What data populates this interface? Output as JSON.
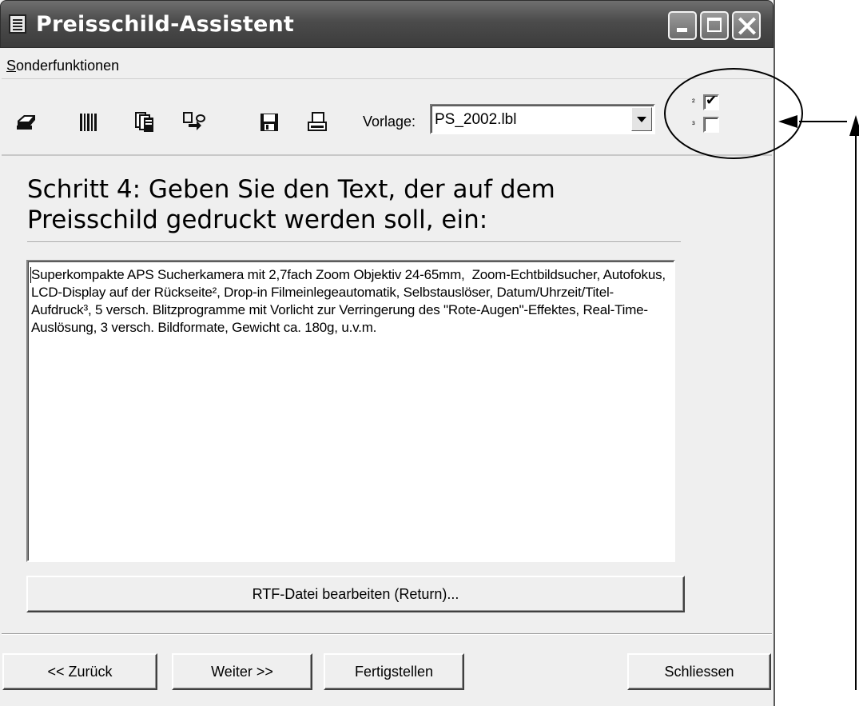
{
  "window": {
    "title": "Preisschild-Assistent"
  },
  "menu": {
    "sonderfunktionen_prefix": "S",
    "sonderfunktionen_rest": "onderfunktionen"
  },
  "toolbar": {
    "icons": [
      "printer-icon",
      "barcode-icon",
      "copy-pages-icon",
      "transfer-icon",
      "save-icon",
      "print-preview-icon"
    ],
    "vorlage_label": "Vorlage:",
    "vorlage_value": "PS_2002.lbl",
    "footnote_2": "²",
    "footnote_3": "³",
    "check_2": true,
    "check_3": false
  },
  "step": {
    "heading": "Schritt 4: Geben Sie den Text, der auf dem Preisschild gedruckt werden soll, ein:"
  },
  "editor": {
    "text": "Superkompakte APS Sucherkamera mit 2,7fach Zoom Objektiv 24-65mm,  Zoom-Echtbildsucher, Autofokus, LCD-Display auf der Rückseite², Drop-in Filmeinlegeautomatik, Selbstauslöser, Datum/Uhrzeit/Titel-Aufdruck³, 5 versch. Blitzprogramme mit Vorlicht zur Verringerung des \"Rote-Augen\"-Effektes, Real-Time-Auslösung, 3 versch. Bildformate, Gewicht ca. 180g, u.v.m."
  },
  "buttons": {
    "rtf": "RTF-Datei bearbeiten (Return)...",
    "back": "<< Zurück",
    "next": "Weiter >>",
    "finish": "Fertigstellen",
    "close": "Schliessen"
  }
}
